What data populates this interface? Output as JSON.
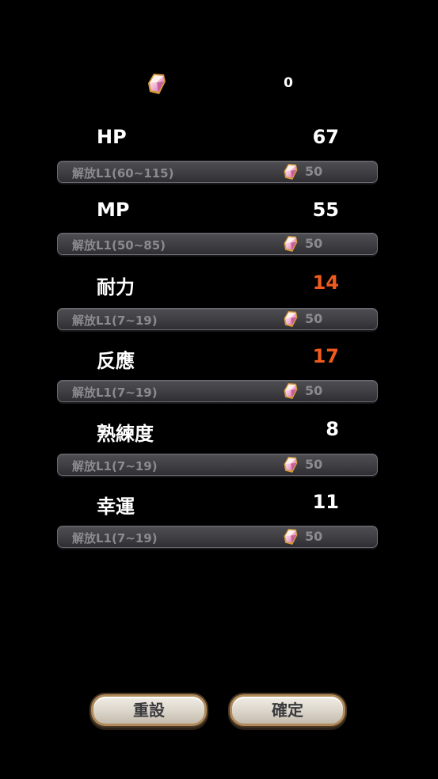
{
  "currency": {
    "icon": "crystal-icon",
    "count": "0"
  },
  "stats": [
    {
      "name": "HP",
      "value": "67",
      "value_color": "#ffffff",
      "unlock_label": "解放L1(60~115)",
      "cost": "50"
    },
    {
      "name": "MP",
      "value": "55",
      "value_color": "#ffffff",
      "unlock_label": "解放L1(50~85)",
      "cost": "50"
    },
    {
      "name": "耐力",
      "value": "14",
      "value_color": "#f05a1e",
      "unlock_label": "解放L1(7~19)",
      "cost": "50"
    },
    {
      "name": "反應",
      "value": "17",
      "value_color": "#f05a1e",
      "unlock_label": "解放L1(7~19)",
      "cost": "50"
    },
    {
      "name": "熟練度",
      "value": "8",
      "value_color": "#ffffff",
      "unlock_label": "解放L1(7~19)",
      "cost": "50"
    },
    {
      "name": "幸運",
      "value": "11",
      "value_color": "#ffffff",
      "unlock_label": "解放L1(7~19)",
      "cost": "50"
    }
  ],
  "buttons": {
    "reset_label": "重設",
    "confirm_label": "確定"
  }
}
